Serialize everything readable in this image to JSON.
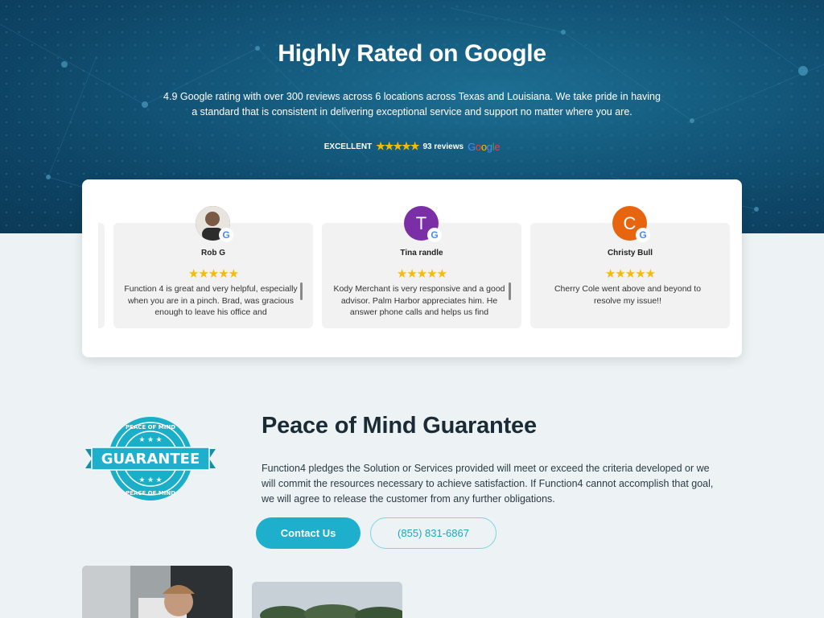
{
  "hero": {
    "title": "Highly Rated on Google",
    "description": "4.9 Google rating with over 300 reviews across 6 locations across Texas and Louisiana. We take pride in having a standard that is consistent in delivering exceptional service and support no matter where you are.",
    "rating_label": "EXCELLENT",
    "stars": "★★★★★",
    "review_count": "93 reviews",
    "google_letters": [
      "G",
      "o",
      "o",
      "g",
      "l",
      "e"
    ]
  },
  "reviews": [
    {
      "name": "Rob G",
      "stars": "★★★★★",
      "text": "Function 4 is great and very helpful, especially when you are in a pinch. Brad, was gracious enough to leave his office and",
      "avatar_letter": "",
      "avatar_color": "#5b4a3f"
    },
    {
      "name": "Tina randle",
      "stars": "★★★★★",
      "text": "Kody Merchant is very responsive and a good advisor. Palm Harbor appreciates him. He answer phone calls and helps us find",
      "avatar_letter": "T",
      "avatar_color": "#7b2fa6"
    },
    {
      "name": "Christy Bull",
      "stars": "★★★★★",
      "text": "Cherry Cole went above and beyond to resolve my issue!!",
      "avatar_letter": "C",
      "avatar_color": "#e8650f"
    }
  ],
  "guarantee": {
    "badge_top": "PEACE OF MIND",
    "badge_main": "GUARANTEE",
    "badge_bottom": "PEACE OF MIND",
    "title": "Peace of Mind Guarantee",
    "text": "Function4 pledges the Solution or Services provided will meet or exceed the criteria developed or we will commit the resources necessary to achieve satisfaction. If Function4 cannot accomplish that goal, we will agree to release the customer from any further obligations.",
    "contact_label": "Contact Us",
    "phone_label": "(855) 831-6867"
  },
  "colors": {
    "accent": "#1dafcc",
    "hero_bg": "#145a7d",
    "star": "#f6bb06"
  }
}
